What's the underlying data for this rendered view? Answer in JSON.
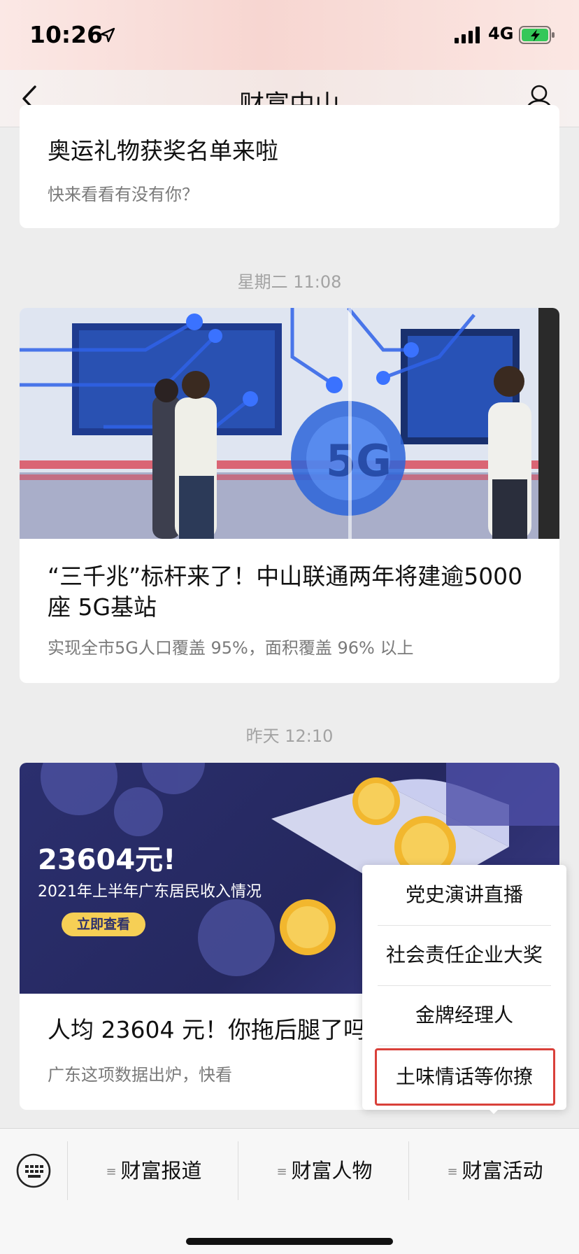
{
  "status_bar": {
    "time": "10:26",
    "network": "4G",
    "icons": [
      "location-arrow-icon",
      "signal-icon",
      "battery-charging-icon"
    ]
  },
  "nav": {
    "title": "财富中山",
    "back_icon": "chevron-left-icon",
    "profile_icon": "person-icon"
  },
  "feed": {
    "card1": {
      "title": "奥运礼物获奖名单来啦",
      "subtitle": "快来看看有没有你？"
    },
    "timestamp2": "星期二 11:08",
    "card2": {
      "title": "“三千兆”标杆来了！中山联通两年将建逾5000座 5G基站",
      "subtitle": "实现全市5G人口覆盖 95%，面积覆盖 96% 以上"
    },
    "timestamp3": "昨天 12:10",
    "card3": {
      "image_headline": "23604元!",
      "image_caption": "2021年上半年广东居民收入情况",
      "image_button": "立即查看",
      "title": "人均 23604 元！你拖后腿了吗",
      "subtitle": "广东这项数据出炉，快看"
    }
  },
  "popup_menu": {
    "items": [
      {
        "label": "党史演讲直播"
      },
      {
        "label": "社会责任企业大奖"
      },
      {
        "label": "金牌经理人"
      },
      {
        "label": "土味情话等你撩"
      }
    ],
    "highlighted_index": 3,
    "highlight_color": "#d9403a"
  },
  "bottom_menu": {
    "keyboard_icon": "keyboard-icon",
    "tabs": [
      {
        "label": "财富报道"
      },
      {
        "label": "财富人物"
      },
      {
        "label": "财富活动"
      }
    ]
  }
}
